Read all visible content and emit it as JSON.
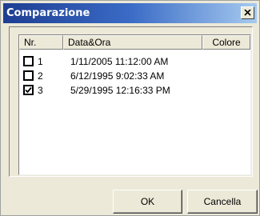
{
  "window": {
    "title": "Comparazione",
    "close_icon": "close-icon"
  },
  "list": {
    "columns": [
      "Nr.",
      "Data&Ora",
      "Colore"
    ],
    "rows": [
      {
        "nr": "1",
        "datetime": "1/11/2005 11:12:00 AM",
        "checked": false
      },
      {
        "nr": "2",
        "datetime": "6/12/1995 9:02:33 AM",
        "checked": false
      },
      {
        "nr": "3",
        "datetime": "5/29/1995 12:16:33 PM",
        "checked": true
      }
    ]
  },
  "buttons": {
    "ok_label": "OK",
    "cancel_label": "Cancella"
  },
  "colors": {
    "titlebar_start": "#1e3e92",
    "titlebar_end": "#a6caf0",
    "dialog_bg": "#ece9d8"
  }
}
